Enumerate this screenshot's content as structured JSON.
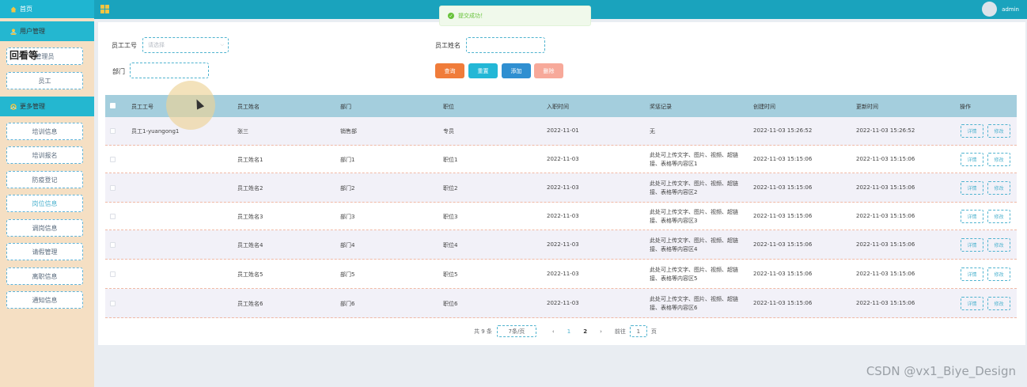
{
  "topbar": {
    "title": "",
    "user": "admin"
  },
  "toast": {
    "message": "提交成功！"
  },
  "sidebar": {
    "home": "首页",
    "group_user": "用户管理",
    "overlay": "回看等",
    "user_items": [
      "管理员",
      "员工"
    ],
    "group_more": "更多管理",
    "more_items": [
      "培训信息",
      "培训报名",
      "防疫登记",
      "岗位信息",
      "调岗信息",
      "请假管理",
      "离职信息",
      "通知信息"
    ]
  },
  "search": {
    "emp_no_label": "员工工号",
    "emp_no_placeholder": "请选择",
    "emp_name_label": "员工姓名",
    "dept_label": "部门"
  },
  "buttons": {
    "query": "查询",
    "reset": "重置",
    "add": "添加",
    "delete": "删除"
  },
  "colors": {
    "query": "#f07c3a",
    "reset": "#23b7d6",
    "add": "#2f8fd1",
    "delete": "#f7a99a"
  },
  "table": {
    "headers": [
      "员工工号",
      "员工姓名",
      "部门",
      "职位",
      "入职时间",
      "奖惩记录",
      "创建时间",
      "更新时间",
      "操作"
    ],
    "op_detail": "详情",
    "op_edit": "修改",
    "rows": [
      {
        "no": "员工1-yuangong1",
        "name": "张三",
        "dept": "销售部",
        "pos": "专员",
        "join": "2022-11-01",
        "rec1": "无",
        "rec2": "",
        "created": "2022-11-03 15:26:52",
        "updated": "2022-11-03 15:26:52"
      },
      {
        "no": "",
        "name": "员工姓名1",
        "dept": "部门1",
        "pos": "职位1",
        "join": "2022-11-03",
        "rec1": "此处可上传文字、图片、视频、超链",
        "rec2": "接、表格等内容区1",
        "created": "2022-11-03 15:15:06",
        "updated": "2022-11-03 15:15:06"
      },
      {
        "no": "",
        "name": "员工姓名2",
        "dept": "部门2",
        "pos": "职位2",
        "join": "2022-11-03",
        "rec1": "此处可上传文字、图片、视频、超链",
        "rec2": "接、表格等内容区2",
        "created": "2022-11-03 15:15:06",
        "updated": "2022-11-03 15:15:06"
      },
      {
        "no": "",
        "name": "员工姓名3",
        "dept": "部门3",
        "pos": "职位3",
        "join": "2022-11-03",
        "rec1": "此处可上传文字、图片、视频、超链",
        "rec2": "接、表格等内容区3",
        "created": "2022-11-03 15:15:06",
        "updated": "2022-11-03 15:15:06"
      },
      {
        "no": "",
        "name": "员工姓名4",
        "dept": "部门4",
        "pos": "职位4",
        "join": "2022-11-03",
        "rec1": "此处可上传文字、图片、视频、超链",
        "rec2": "接、表格等内容区4",
        "created": "2022-11-03 15:15:06",
        "updated": "2022-11-03 15:15:06"
      },
      {
        "no": "",
        "name": "员工姓名5",
        "dept": "部门5",
        "pos": "职位5",
        "join": "2022-11-03",
        "rec1": "此处可上传文字、图片、视频、超链",
        "rec2": "接、表格等内容区5",
        "created": "2022-11-03 15:15:06",
        "updated": "2022-11-03 15:15:06"
      },
      {
        "no": "",
        "name": "员工姓名6",
        "dept": "部门6",
        "pos": "职位6",
        "join": "2022-11-03",
        "rec1": "此处可上传文字、图片、视频、超链",
        "rec2": "接、表格等内容区6",
        "created": "2022-11-03 15:15:06",
        "updated": "2022-11-03 15:15:06"
      }
    ]
  },
  "pager": {
    "total": "共 9 条",
    "page_size": "7条/页",
    "pages": [
      "1",
      "2"
    ],
    "goto": "前往",
    "goto_value": "1",
    "page_unit": "页"
  },
  "watermark": "CSDN @vx1_Biye_Design"
}
